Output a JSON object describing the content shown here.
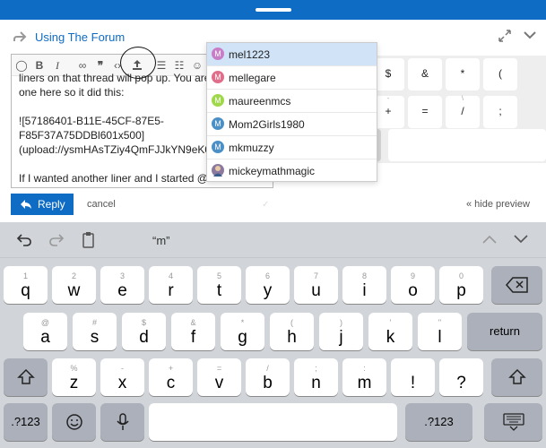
{
  "composer": {
    "topic": "Using The Forum",
    "editor_text": "liners on that thread will pop up. You are\none here so it did this:\n\n![57186401-B11E-45CF-87E5-\nF85F37A75DDBl601x500]\n(upload://ysmHAsTZiy4QmFJJkYN9eK0\n\nIf I wanted another liner and I started @...",
    "reply_label": "Reply",
    "cancel_label": "cancel",
    "hide_preview_label": "« hide preview"
  },
  "toolbar": [
    "bold",
    "italic",
    "link",
    "quote",
    "code",
    "upload",
    "bullets",
    "numbered",
    "emoji"
  ],
  "autocomplete": [
    {
      "initial": "M",
      "name": "mel1223",
      "color": "#c77ec7"
    },
    {
      "initial": "M",
      "name": "mellegare",
      "color": "#e06e8a"
    },
    {
      "initial": "M",
      "name": "maureenmcs",
      "color": "#9fd84a"
    },
    {
      "initial": "M",
      "name": "Mom2Girls1980",
      "color": "#4b8fc7"
    },
    {
      "initial": "M",
      "name": "mkmuzzy",
      "color": "#4b8fc7"
    },
    {
      "initial": "",
      "name": "mickeymathmagic",
      "color": "#8c7a9e"
    }
  ],
  "background_keys": {
    "row1": [
      [
        "",
        "$"
      ],
      [
        "",
        "&"
      ],
      [
        "",
        "*"
      ],
      [
        "",
        "("
      ]
    ],
    "row2": [
      [
        "-",
        "+"
      ],
      [
        "",
        "="
      ],
      [
        "\\",
        "/"
      ],
      [
        "",
        ";"
      ]
    ]
  },
  "keyboard": {
    "prediction": "“m”",
    "row1": [
      [
        "1",
        "q"
      ],
      [
        "2",
        "w"
      ],
      [
        "3",
        "e"
      ],
      [
        "4",
        "r"
      ],
      [
        "5",
        "t"
      ],
      [
        "6",
        "y"
      ],
      [
        "7",
        "u"
      ],
      [
        "8",
        "i"
      ],
      [
        "9",
        "o"
      ],
      [
        "0",
        "p"
      ]
    ],
    "row2": [
      [
        "@",
        "a"
      ],
      [
        "#",
        "s"
      ],
      [
        "$",
        "d"
      ],
      [
        "&",
        "f"
      ],
      [
        "*",
        "g"
      ],
      [
        "(",
        "h"
      ],
      [
        ")",
        "j"
      ],
      [
        "'",
        "k"
      ],
      [
        "\"",
        "l"
      ]
    ],
    "row3": [
      [
        "%",
        "z"
      ],
      [
        "-",
        "x"
      ],
      [
        "+",
        "c"
      ],
      [
        "=",
        "v"
      ],
      [
        "/",
        "b"
      ],
      [
        ";",
        "n"
      ],
      [
        ":",
        "m"
      ],
      [
        "",
        "!"
      ],
      [
        "",
        "?"
      ]
    ],
    "return_label": "return",
    "numbers_label": ".?123"
  }
}
